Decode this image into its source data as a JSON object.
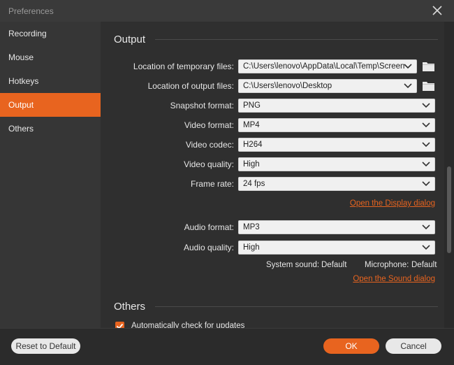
{
  "window": {
    "title": "Preferences"
  },
  "sidebar": {
    "items": [
      {
        "label": "Recording"
      },
      {
        "label": "Mouse"
      },
      {
        "label": "Hotkeys"
      },
      {
        "label": "Output",
        "active": true
      },
      {
        "label": "Others"
      }
    ]
  },
  "output": {
    "heading": "Output",
    "temp_files": {
      "label": "Location of temporary files:",
      "value": "C:\\Users\\lenovo\\AppData\\Local\\Temp\\Screen"
    },
    "output_files": {
      "label": "Location of output files:",
      "value": "C:\\Users\\lenovo\\Desktop"
    },
    "snapshot_format": {
      "label": "Snapshot format:",
      "value": "PNG"
    },
    "video_format": {
      "label": "Video format:",
      "value": "MP4"
    },
    "video_codec": {
      "label": "Video codec:",
      "value": "H264"
    },
    "video_quality": {
      "label": "Video quality:",
      "value": "High"
    },
    "frame_rate": {
      "label": "Frame rate:",
      "value": "24 fps"
    },
    "display_link": "Open the Display dialog",
    "audio_format": {
      "label": "Audio format:",
      "value": "MP3"
    },
    "audio_quality": {
      "label": "Audio quality:",
      "value": "High"
    },
    "system_sound": {
      "label": "System sound:",
      "value": "Default"
    },
    "microphone": {
      "label": "Microphone:",
      "value": "Default"
    },
    "sound_link": "Open the Sound dialog"
  },
  "others": {
    "heading": "Others",
    "auto_update": {
      "label": "Automatically check for updates",
      "checked": true
    }
  },
  "footer": {
    "reset_label": "Reset to Default",
    "ok_label": "OK",
    "cancel_label": "Cancel"
  },
  "colors": {
    "accent": "#e8641f",
    "background": "#2f2f2f",
    "sidebar": "#363636"
  }
}
